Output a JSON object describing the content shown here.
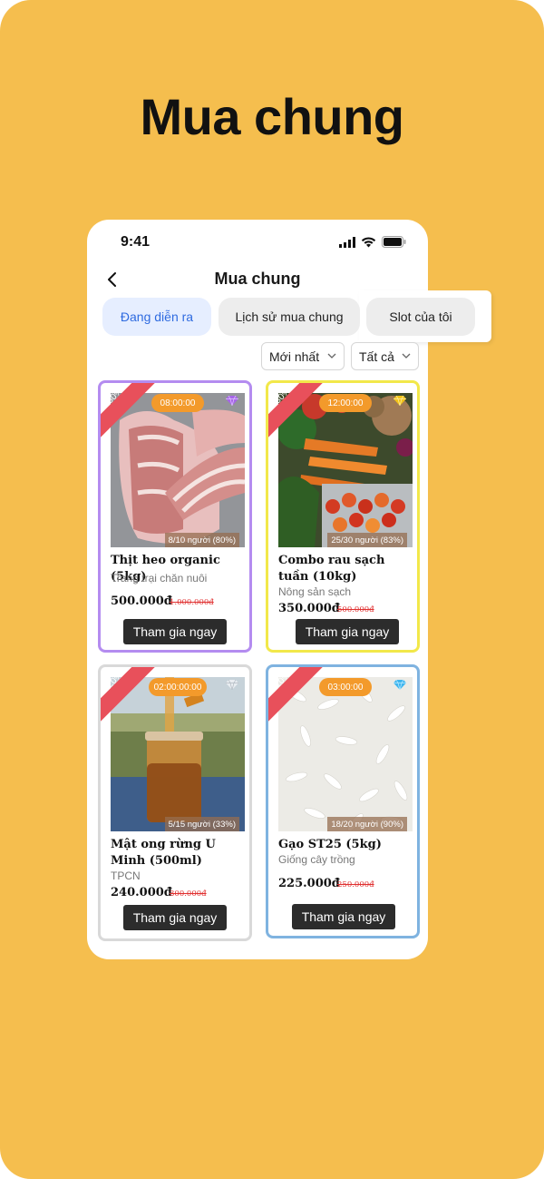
{
  "headline": "Mua chung",
  "status_bar": {
    "time": "9:41"
  },
  "nav": {
    "title": "Mua chung"
  },
  "tabs": [
    {
      "label": "Đang diễn ra",
      "active": true
    },
    {
      "label": "Lịch sử mua chung",
      "active": false
    },
    {
      "label": "Slot của tôi",
      "active": false
    }
  ],
  "filters": {
    "sort": "Mới nhất",
    "category": "Tất cả"
  },
  "products": [
    {
      "discount": "-50%",
      "timer": "08:00:00",
      "gem": "purple-gem-icon",
      "progress": "8/10 người (80%)",
      "name": "Thịt heo organic (5kg)",
      "shop": "Trang trại chăn nuôi",
      "price": "500.000đ",
      "old_price": "1.000.000đ",
      "button": "Tham gia ngay",
      "border": "#B48CF0"
    },
    {
      "discount": "-30%",
      "timer": "12:00:00",
      "gem": "yellow-gem-icon",
      "progress": "25/30 người (83%)",
      "name": "Combo rau sạch tuần (10kg)",
      "shop": "Nông sản sạch",
      "price": "350.000đ",
      "old_price": "500.000đ",
      "button": "Tham gia ngay",
      "border": "#F2E84A"
    },
    {
      "discount": "-20%",
      "timer": "02:00:00:00",
      "gem": "white-gem-icon",
      "progress": "5/15 người (33%)",
      "name": "Mật ong rừng U Minh (500ml)",
      "shop": "TPCN",
      "price": "240.000đ",
      "old_price": "300.000đ",
      "button": "Tham gia ngay",
      "border": "#D9D9D9"
    },
    {
      "discount": "-10%",
      "timer": "03:00:00",
      "gem": "blue-gem-icon",
      "progress": "18/20 người (90%)",
      "name": "Gạo ST25 (5kg)",
      "shop": "Giống cây trồng",
      "price": "225.000đ",
      "old_price": "250.000đ",
      "button": "Tham gia ngay",
      "border": "#7FB3E0"
    }
  ]
}
